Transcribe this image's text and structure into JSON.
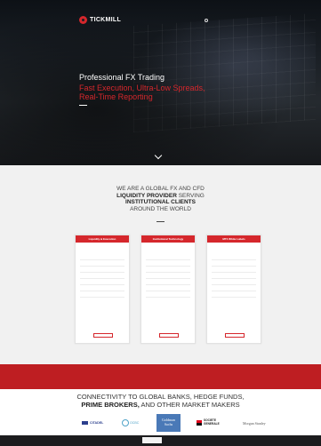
{
  "top_notice": "",
  "brand": {
    "name": "TICKMILL",
    "sub": ""
  },
  "nav": {
    "items": [
      "",
      "",
      "",
      "",
      ""
    ]
  },
  "hero": {
    "title": "Professional FX Trading",
    "subtitle": "Fast Execution, Ultra-Low Spreads, Real-Time Reporting"
  },
  "intro": {
    "line1": "WE ARE A GLOBAL FX AND CFD",
    "line2": "LIQUIDITY PROVIDER",
    "line2b": " SERVING",
    "line3": "INSTITUTIONAL CLIENTS",
    "line4": "AROUND THE WORLD"
  },
  "cards": [
    {
      "title": "Liquidity & Execution",
      "desc": "",
      "items": [
        "",
        "",
        "",
        "",
        "",
        "",
        ""
      ],
      "button": ""
    },
    {
      "title": "Institutional Technology",
      "desc": "",
      "items": [
        "",
        "",
        "",
        "",
        "",
        "",
        ""
      ],
      "button": ""
    },
    {
      "title": "MT4 White Labels",
      "desc": "",
      "items": [
        "",
        "",
        "",
        "",
        "",
        "",
        ""
      ],
      "button": ""
    }
  ],
  "band": {
    "text": ""
  },
  "connectivity": {
    "line1": "CONNECTIVITY TO GLOBAL BANKS, HEDGE FUNDS,",
    "line2": "PRIME BROKERS,",
    "line2b": " AND OTHER MARKET MAKERS"
  },
  "partners": {
    "citadel": "CITADEL",
    "ocbc": "OCBC",
    "gs_line1": "Goldman",
    "gs_line2": "Sachs",
    "sg_line1": "SOCIETE",
    "sg_line2": "GENERALE",
    "ms": "Morgan Stanley"
  },
  "footer": {
    "col1": "",
    "col2": ""
  },
  "colors": {
    "accent": "#d5272c",
    "band": "#be1e22",
    "hero_bg": "#1b2026",
    "section_bg": "#f1f1f1"
  }
}
